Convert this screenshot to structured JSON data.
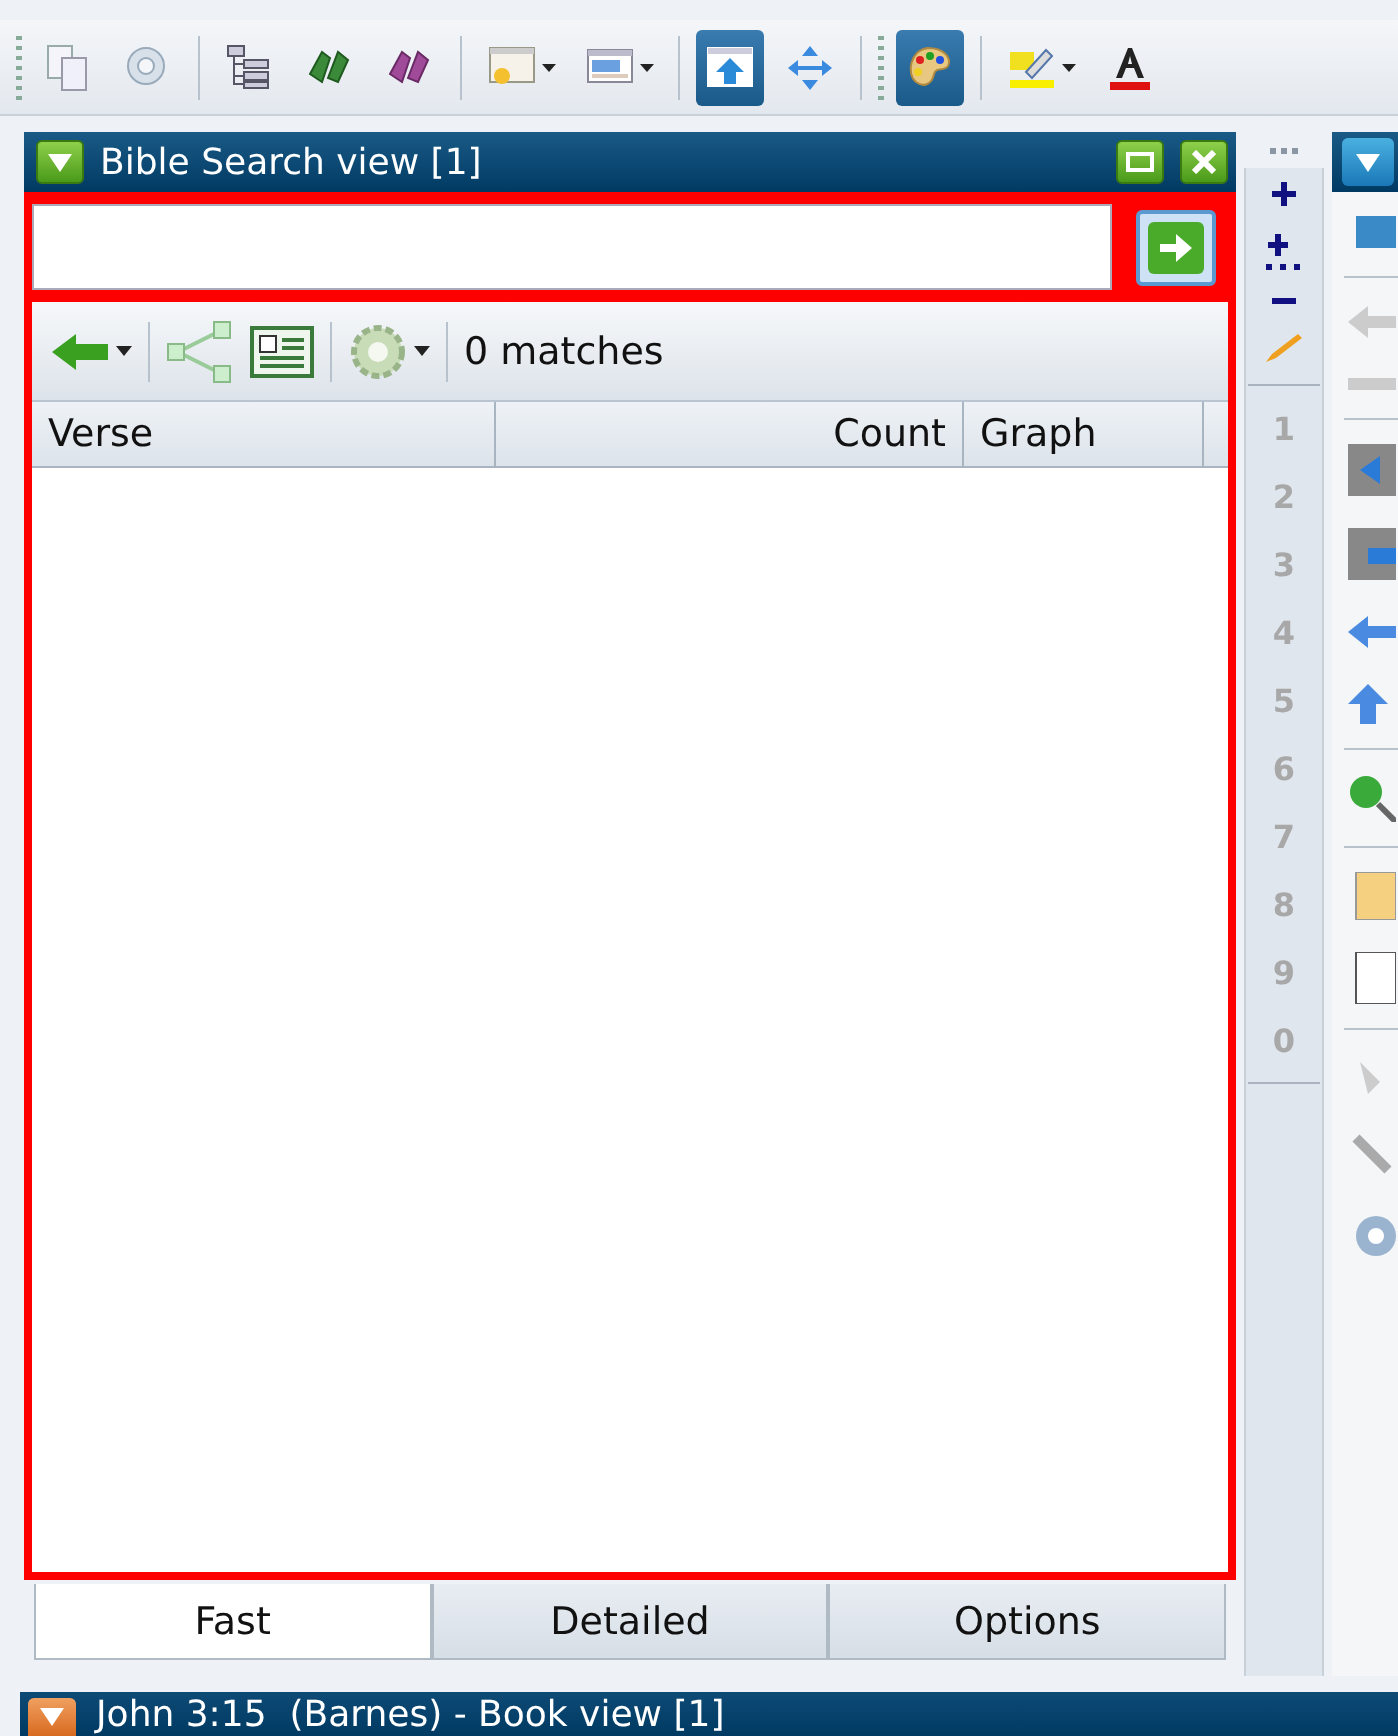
{
  "toolbar": {
    "buttons": [
      {
        "kind": "copy",
        "pressed": false
      },
      {
        "kind": "gear",
        "pressed": false
      },
      {
        "kind": "tree",
        "pressed": false
      },
      {
        "kind": "binoculars-green",
        "pressed": false
      },
      {
        "kind": "binoculars-purple",
        "pressed": false
      },
      {
        "kind": "window-sun",
        "pressed": false
      },
      {
        "kind": "window-layout",
        "pressed": false
      },
      {
        "kind": "window-up",
        "pressed": true
      },
      {
        "kind": "move",
        "pressed": false
      },
      {
        "kind": "palette",
        "pressed": true
      },
      {
        "kind": "highlight",
        "pressed": false
      },
      {
        "kind": "font-color",
        "pressed": false
      }
    ]
  },
  "search_view": {
    "title": "Bible Search view [1]",
    "match_count": "0 matches",
    "columns": [
      "Verse",
      "Count",
      "Graph"
    ],
    "tabs": [
      {
        "label": "Fast",
        "selected": true
      },
      {
        "label": "Detailed",
        "selected": false
      },
      {
        "label": "Options",
        "selected": false
      }
    ]
  },
  "key_strip": {
    "keys": [
      "1",
      "2",
      "3",
      "4",
      "5",
      "6",
      "7",
      "8",
      "9",
      "0"
    ]
  },
  "book_view": {
    "title": "John 3:15  (Barnes) - Book view [1]"
  }
}
